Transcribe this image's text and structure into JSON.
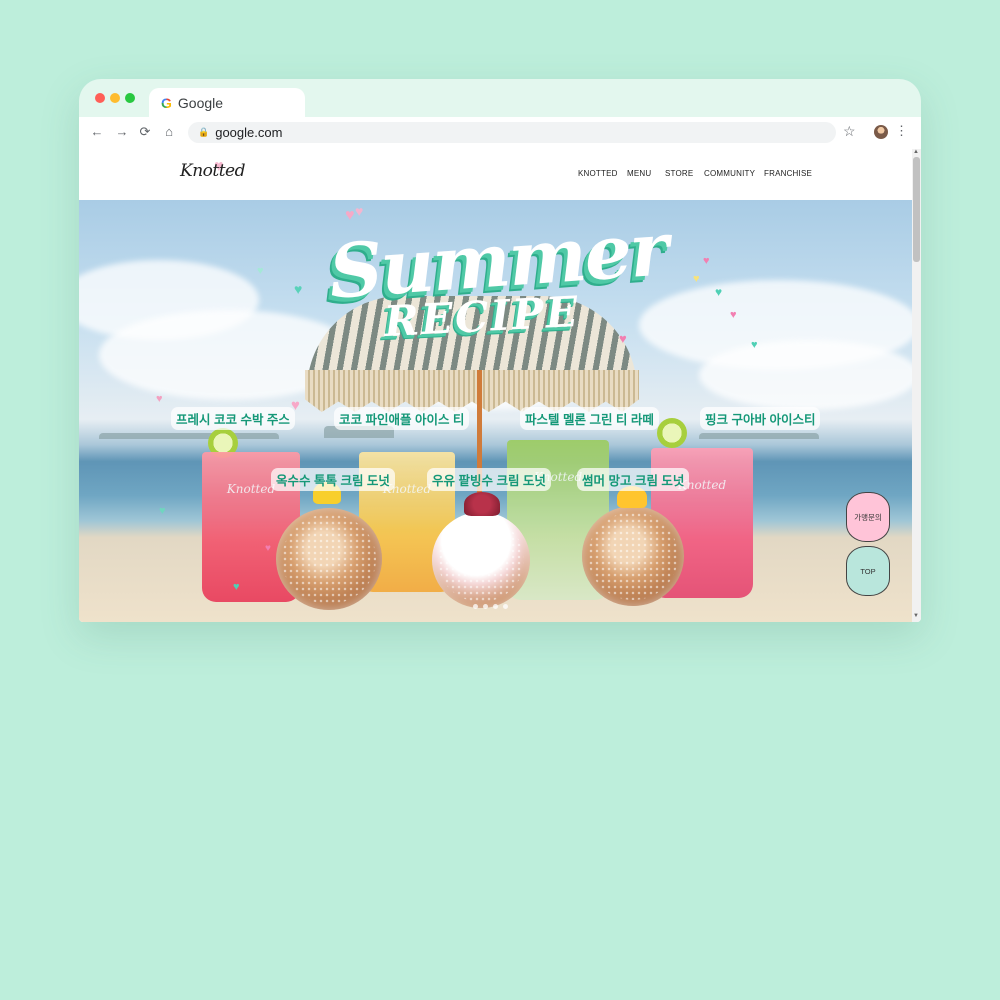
{
  "browser": {
    "tab_title": "Google",
    "tab_icon": "G",
    "url": "google.com",
    "back_icon": "←",
    "forward_icon": "→",
    "reload_icon": "⟳",
    "home_icon": "⌂",
    "lock_icon": "🔒",
    "star_icon": "☆",
    "menu_icon": "⋮"
  },
  "site": {
    "logo": "Knotted",
    "nav": [
      "KNOTTED",
      "MENU",
      "STORE",
      "COMMUNITY",
      "FRANCHISE"
    ]
  },
  "hero": {
    "headline": "Summer",
    "subheadline": "RECIPE",
    "cup_brand": "Knotted",
    "drinks": [
      "프레시 코코 수박 주스",
      "코코 파인애플 아이스 티",
      "파스텔 멜론 그린 티 라떼",
      "핑크 구아바 아이스티"
    ],
    "donuts": [
      "옥수수 톡톡 크림 도넛",
      "우유 팥빙수 크림 도넛",
      "썸머 망고 크림 도넛"
    ]
  },
  "floating": {
    "inquiry": "가맹문의",
    "top": "TOP"
  },
  "colors": {
    "page_bg": "#bdeedb",
    "accent_mint": "#2fae8c",
    "label_text": "#159878",
    "pink_button": "#ffc4d8",
    "mint_button": "#b9e6dc"
  }
}
